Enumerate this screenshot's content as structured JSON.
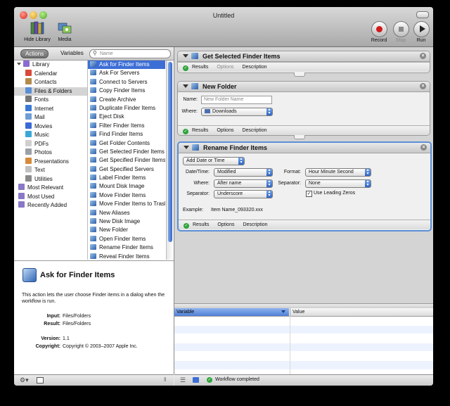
{
  "window": {
    "title": "Untitled"
  },
  "toolbar": {
    "hide_library": "Hide Library",
    "media": "Media",
    "record": "Record",
    "stop": "Stop",
    "run": "Run"
  },
  "left": {
    "tab_actions": "Actions",
    "tab_variables": "Variables",
    "search_placeholder": "Name",
    "library": [
      {
        "label": "Library",
        "icon": "library-icon",
        "color": "#8a6bd1"
      },
      {
        "label": "Calendar",
        "icon": "calendar-icon",
        "color": "#d94a3a"
      },
      {
        "label": "Contacts",
        "icon": "contacts-icon",
        "color": "#b48a4a"
      },
      {
        "label": "Files & Folders",
        "icon": "finder-icon",
        "color": "#5a8fd6"
      },
      {
        "label": "Fonts",
        "icon": "fonts-icon",
        "color": "#777777"
      },
      {
        "label": "Internet",
        "icon": "globe-icon",
        "color": "#3a7ad6"
      },
      {
        "label": "Mail",
        "icon": "mail-icon",
        "color": "#6f9ed6"
      },
      {
        "label": "Movies",
        "icon": "movies-icon",
        "color": "#3a6ad6"
      },
      {
        "label": "Music",
        "icon": "music-icon",
        "color": "#3aa8d6"
      },
      {
        "label": "PDFs",
        "icon": "pdf-icon",
        "color": "#cfcfcf"
      },
      {
        "label": "Photos",
        "icon": "photos-icon",
        "color": "#9aa0a6"
      },
      {
        "label": "Presentations",
        "icon": "presentations-icon",
        "color": "#d68a3a"
      },
      {
        "label": "Text",
        "icon": "text-icon",
        "color": "#c0c0c0"
      },
      {
        "label": "Utilities",
        "icon": "utilities-icon",
        "color": "#8a8a8a"
      },
      {
        "label": "Most Relevant",
        "icon": "smart-folder-icon",
        "color": "#8a78c6"
      },
      {
        "label": "Most Used",
        "icon": "smart-folder-icon",
        "color": "#8a78c6"
      },
      {
        "label": "Recently Added",
        "icon": "smart-folder-icon",
        "color": "#8a78c6"
      }
    ],
    "actions": [
      "Ask for Finder Items",
      "Ask For Servers",
      "Connect to Servers",
      "Copy Finder Items",
      "Create Archive",
      "Duplicate Finder Items",
      "Eject Disk",
      "Filter Finder Items",
      "Find Finder Items",
      "Get Folder Contents",
      "Get Selected Finder Items",
      "Get Specified Finder Items",
      "Get Specified Servers",
      "Label Finder Items",
      "Mount Disk Image",
      "Move Finder Items",
      "Move Finder Items to Trash",
      "New Aliases",
      "New Disk Image",
      "New Folder",
      "Open Finder Items",
      "Rename Finder Items",
      "Reveal Finder Items"
    ],
    "description": {
      "title": "Ask for Finder Items",
      "text": "This action lets the user choose Finder items in a dialog when the workflow is run.",
      "input_label": "Input:",
      "input_value": "Files/Folders",
      "result_label": "Result:",
      "result_value": "Files/Folders",
      "version_label": "Version:",
      "version_value": "1.1",
      "copyright_label": "Copyright:",
      "copyright_value": "Copyright © 2003–2007 Apple Inc."
    }
  },
  "workflow": {
    "tabs": {
      "results": "Results",
      "options": "Options",
      "description": "Description"
    },
    "action1": {
      "title": "Get Selected Finder Items"
    },
    "action2": {
      "title": "New Folder",
      "name_label": "Name:",
      "name_placeholder": "New Folder Name",
      "where_label": "Where:",
      "where_value": "Downloads"
    },
    "action3": {
      "title": "Rename Finder Items",
      "mode": "Add Date or Time",
      "datetime_label": "Date/Time:",
      "datetime_value": "Modified",
      "where_label": "Where:",
      "where_value": "After name",
      "separator_label": "Separator:",
      "separator_value": "Underscore",
      "format_label": "Format:",
      "format_value": "Hour Minute Second",
      "separator2_label": "Separator:",
      "separator2_value": "None",
      "leading_zeros": "Use Leading Zeros",
      "example_label": "Example:",
      "example_value": "Item Name_093320.xxx"
    }
  },
  "variables": {
    "col_variable": "Variable",
    "col_value": "Value"
  },
  "status": {
    "text": "Workflow completed"
  }
}
